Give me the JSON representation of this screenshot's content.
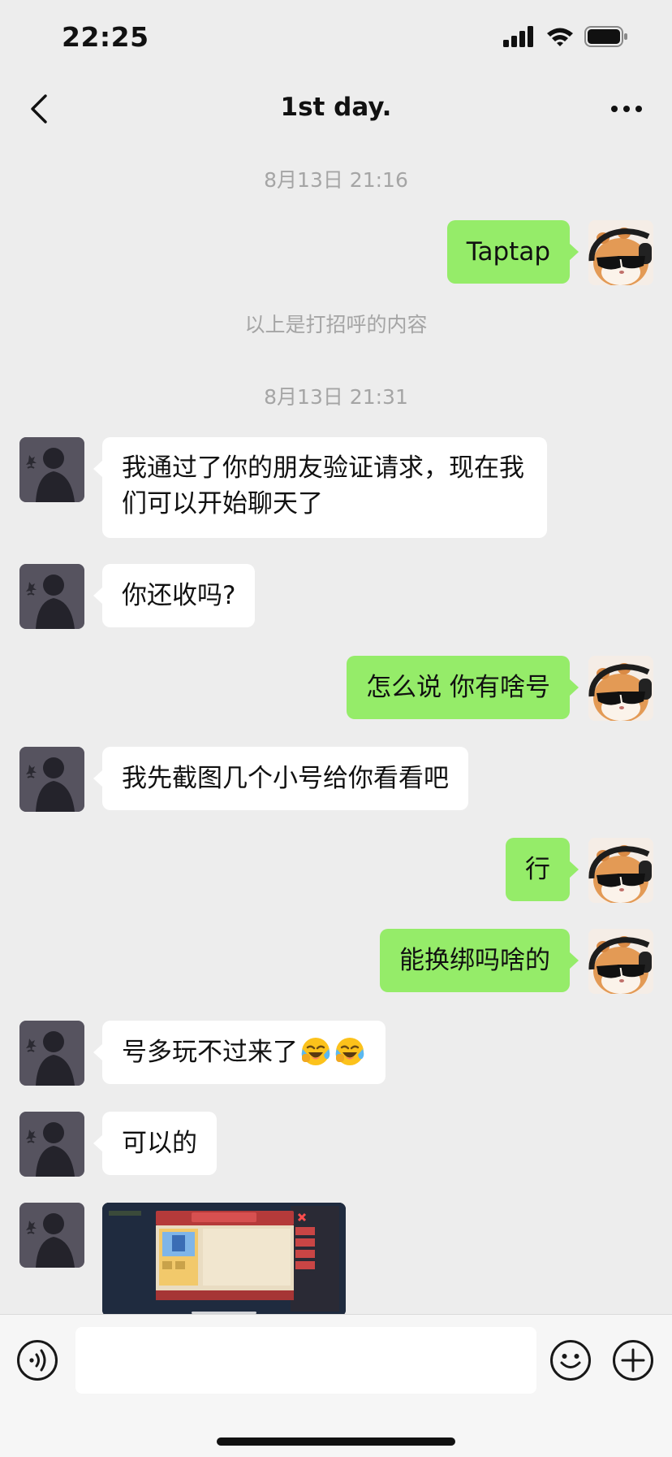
{
  "status_bar": {
    "time": "22:25"
  },
  "header": {
    "title": "1st day."
  },
  "messages": {
    "ts1": "8月13日 21:16",
    "m1": "Taptap",
    "sys1": "以上是打招呼的内容",
    "ts2": "8月13日 21:31",
    "m2": "我通过了你的朋友验证请求，现在我们可以开始聊天了",
    "m3": "你还收吗?",
    "m4": "怎么说 你有啥号",
    "m5": "我先截图几个小号给你看看吧",
    "m6": "行",
    "m7": "能换绑吗啥的",
    "m8": "号多玩不过来了",
    "m9": "可以的"
  },
  "input": {
    "value": ""
  },
  "colors": {
    "background": "#ededed",
    "outgoing_bubble": "#95ec69",
    "incoming_bubble": "#ffffff",
    "timestamp": "#a5a5a5"
  }
}
